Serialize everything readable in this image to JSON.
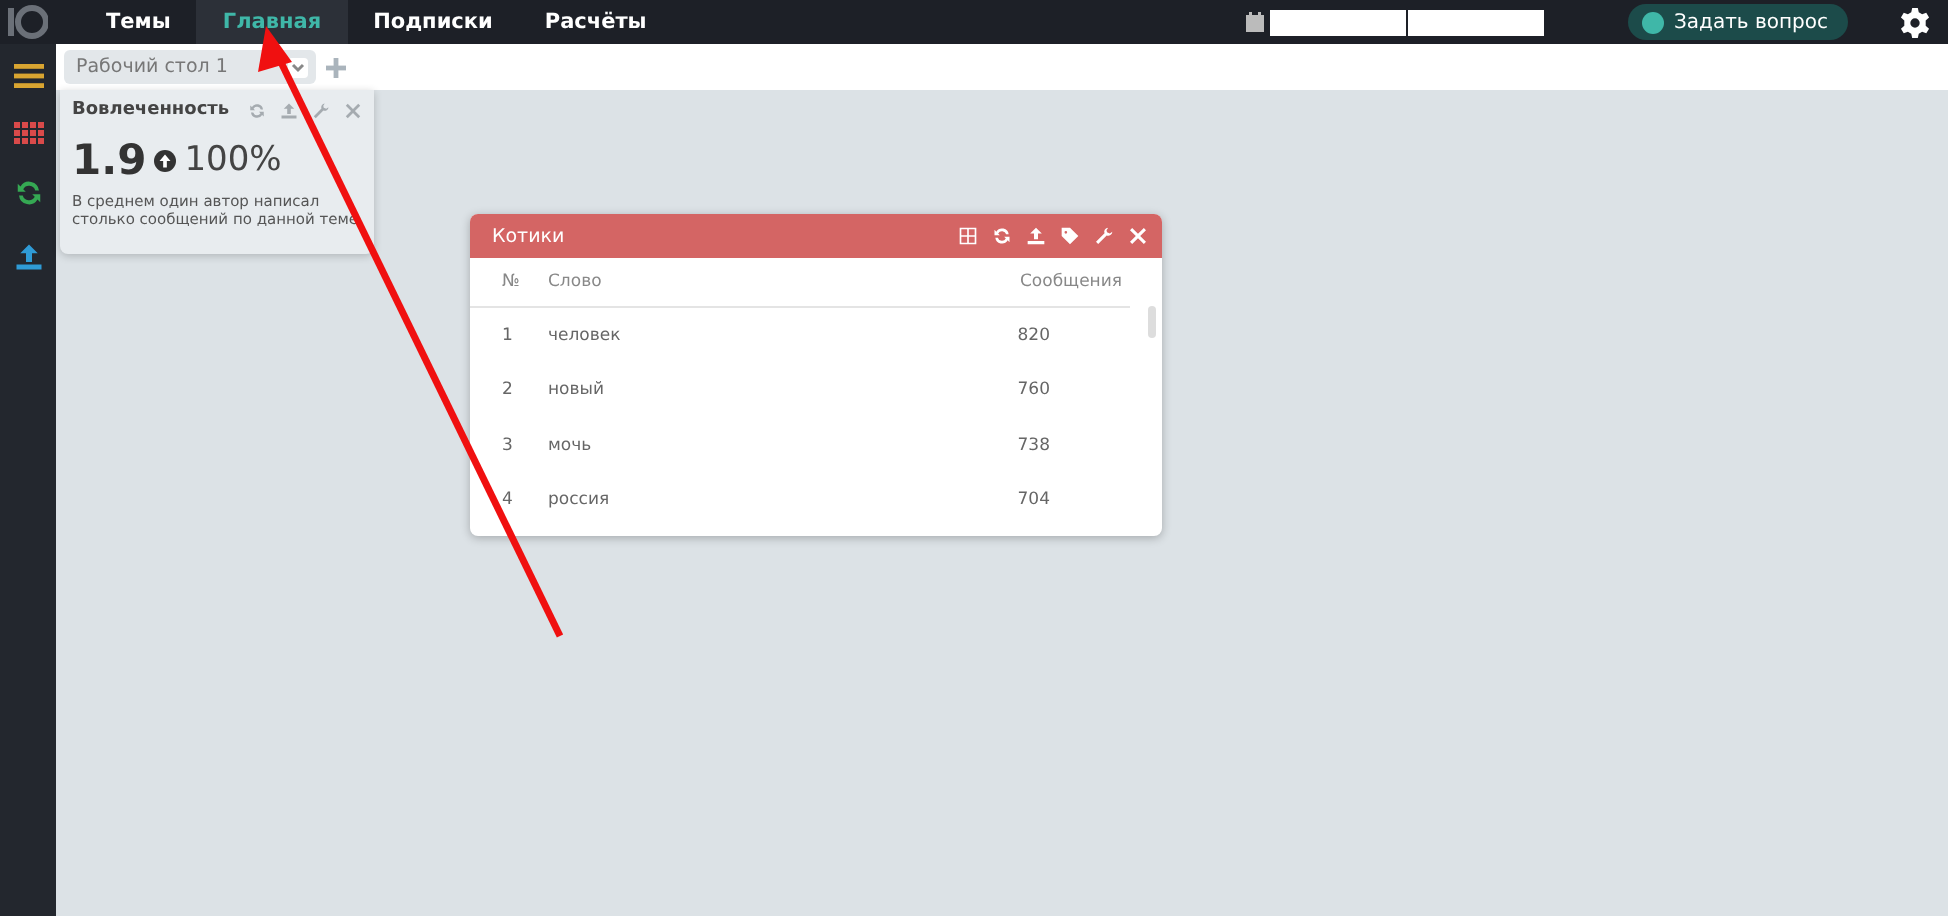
{
  "nav": {
    "items": [
      {
        "label": "Темы",
        "selected": false
      },
      {
        "label": "Главная",
        "selected": true
      },
      {
        "label": "Подписки",
        "selected": false
      },
      {
        "label": "Расчёты",
        "selected": false
      }
    ]
  },
  "header": {
    "ask_button": "Задать вопрос"
  },
  "workspace": {
    "selector": "Рабочий стол 1"
  },
  "engagement_widget": {
    "title": "Вовлеченность",
    "value": "1.9",
    "change": "100%",
    "description": "В среднем один автор написал столько сообщений по данной теме"
  },
  "table_widget": {
    "title": "Котики",
    "columns": [
      "№",
      "Слово",
      "Сообщения"
    ],
    "rows": [
      [
        "1",
        "человек",
        "820"
      ],
      [
        "2",
        "новый",
        "760"
      ],
      [
        "3",
        "мочь",
        "738"
      ],
      [
        "4",
        "россия",
        "704"
      ]
    ]
  }
}
